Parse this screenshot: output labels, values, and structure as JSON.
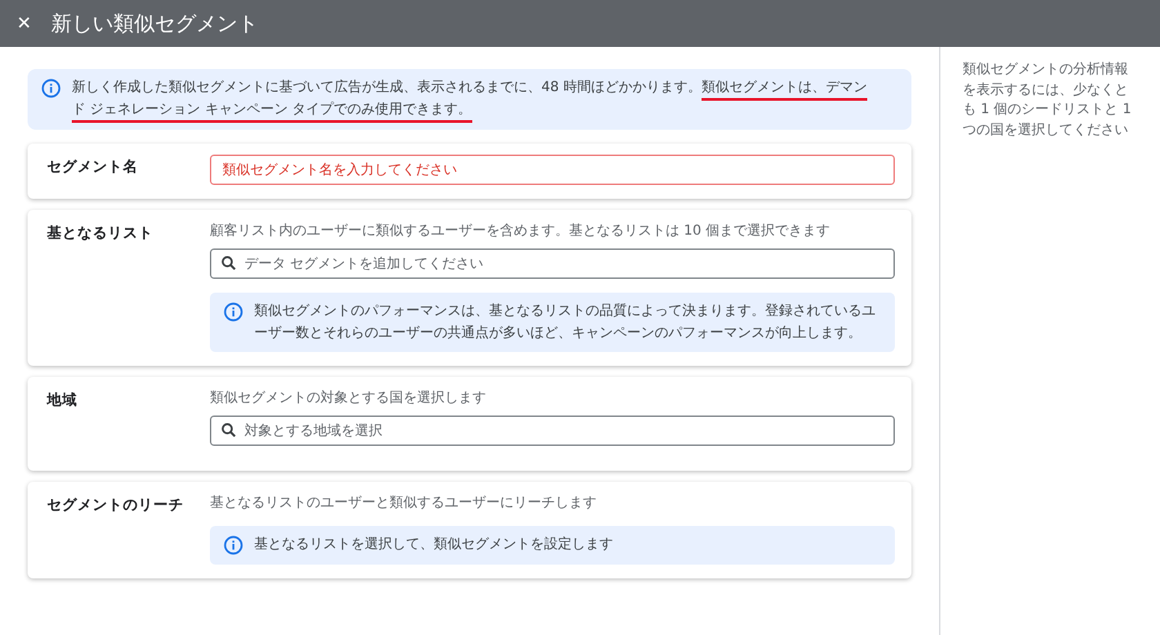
{
  "header": {
    "close_icon": "✕",
    "title": "新しい類似セグメント"
  },
  "banner": {
    "segments": [
      {
        "text": "新しく作成した類似セグメントに基づいて広告が生成、表示されるまでに、48 時間ほどかかります。",
        "underlined": false
      },
      {
        "text": "類似セグメントは、デマンド ジェネレーション キャンペーン タイプでのみ使用できます。",
        "underlined": true
      }
    ]
  },
  "sections": [
    {
      "label": "セグメント名",
      "kind": "text_input",
      "placeholder": "類似セグメント名を入力してください",
      "invalid": true
    },
    {
      "label": "基となるリスト",
      "kind": "search",
      "description": "顧客リスト内のユーザーに類似するユーザーを含めます。基となるリストは 10 個まで選択できます",
      "placeholder": "データ セグメントを追加してください",
      "note": "類似セグメントのパフォーマンスは、基となるリストの品質によって決まります。登録されているユーザー数とそれらのユーザーの共通点が多いほど、キャンペーンのパフォーマンスが向上します。"
    },
    {
      "label": "地域",
      "kind": "search",
      "description": "類似セグメントの対象とする国を選択します",
      "placeholder": "対象とする地域を選択"
    },
    {
      "label": "セグメントのリーチ",
      "kind": "info",
      "description": "基となるリストのユーザーと類似するユーザーにリーチします",
      "note": "基となるリストを選択して、類似セグメントを設定します"
    }
  ],
  "side_panel": {
    "text": "類似セグメントの分析情報を表示するには、少なくとも 1 個のシードリストと 1 つの国を選択してください"
  }
}
